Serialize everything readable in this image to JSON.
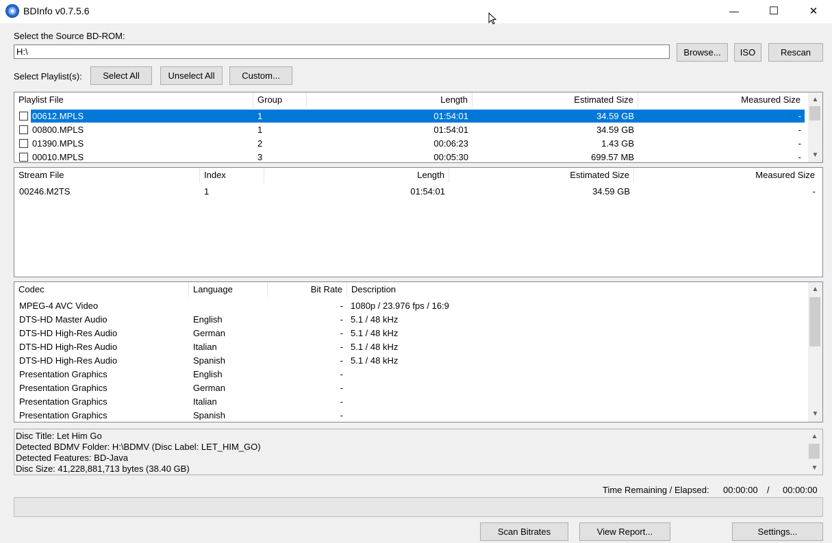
{
  "window": {
    "title": "BDInfo v0.7.5.6",
    "minimize_glyph": "—",
    "maximize_glyph": "☐",
    "close_glyph": "✕"
  },
  "source": {
    "label": "Select the Source BD-ROM:",
    "path": "H:\\",
    "browse_label": "Browse...",
    "iso_label": "ISO",
    "rescan_label": "Rescan"
  },
  "playlist_select": {
    "label": "Select Playlist(s):",
    "select_all_label": "Select All",
    "unselect_all_label": "Unselect All",
    "custom_label": "Custom..."
  },
  "playlists": {
    "headers": [
      "Playlist File",
      "Group",
      "Length",
      "Estimated Size",
      "Measured Size"
    ],
    "rows": [
      {
        "file": "00612.MPLS",
        "group": "1",
        "length": "01:54:01",
        "estimated": "34.59 GB",
        "measured": "-"
      },
      {
        "file": "00800.MPLS",
        "group": "1",
        "length": "01:54:01",
        "estimated": "34.59 GB",
        "measured": "-"
      },
      {
        "file": "01390.MPLS",
        "group": "2",
        "length": "00:06:23",
        "estimated": "1.43 GB",
        "measured": "-"
      },
      {
        "file": "00010.MPLS",
        "group": "3",
        "length": "00:05:30",
        "estimated": "699.57 MB",
        "measured": "-"
      }
    ]
  },
  "streams": {
    "headers": [
      "Stream File",
      "Index",
      "Length",
      "Estimated Size",
      "Measured Size"
    ],
    "rows": [
      {
        "file": "00246.M2TS",
        "index": "1",
        "length": "01:54:01",
        "estimated": "34.59 GB",
        "measured": "-"
      }
    ]
  },
  "codecs": {
    "headers": [
      "Codec",
      "Language",
      "Bit Rate",
      "Description"
    ],
    "rows": [
      {
        "codec": "MPEG-4 AVC Video",
        "language": "",
        "bitrate": "-",
        "description": "1080p / 23.976 fps / 16:9"
      },
      {
        "codec": "DTS-HD Master Audio",
        "language": "English",
        "bitrate": "-",
        "description": "5.1 / 48 kHz"
      },
      {
        "codec": "DTS-HD High-Res Audio",
        "language": "German",
        "bitrate": "-",
        "description": "5.1 / 48 kHz"
      },
      {
        "codec": "DTS-HD High-Res Audio",
        "language": "Italian",
        "bitrate": "-",
        "description": "5.1 / 48 kHz"
      },
      {
        "codec": "DTS-HD High-Res Audio",
        "language": "Spanish",
        "bitrate": "-",
        "description": "5.1 / 48 kHz"
      },
      {
        "codec": "Presentation Graphics",
        "language": "English",
        "bitrate": "-",
        "description": ""
      },
      {
        "codec": "Presentation Graphics",
        "language": "German",
        "bitrate": "-",
        "description": ""
      },
      {
        "codec": "Presentation Graphics",
        "language": "Italian",
        "bitrate": "-",
        "description": ""
      },
      {
        "codec": "Presentation Graphics",
        "language": "Spanish",
        "bitrate": "-",
        "description": ""
      }
    ]
  },
  "disc_info": {
    "lines": [
      "Disc Title: Let Him Go",
      "Detected BDMV Folder: H:\\BDMV (Disc Label: LET_HIM_GO)",
      "Detected Features: BD-Java",
      "Disc Size: 41,228,881,713 bytes (38.40 GB)"
    ]
  },
  "status": {
    "time_label": "Time Remaining / Elapsed:",
    "remaining": "00:00:00",
    "separator": "/",
    "elapsed": "00:00:00",
    "progress": 0
  },
  "footer": {
    "scan_label": "Scan Bitrates",
    "report_label": "View Report...",
    "settings_label": "Settings..."
  },
  "icons": {
    "app": "bluray-disc-icon",
    "scroll_up": "▲",
    "scroll_down": "▼"
  }
}
